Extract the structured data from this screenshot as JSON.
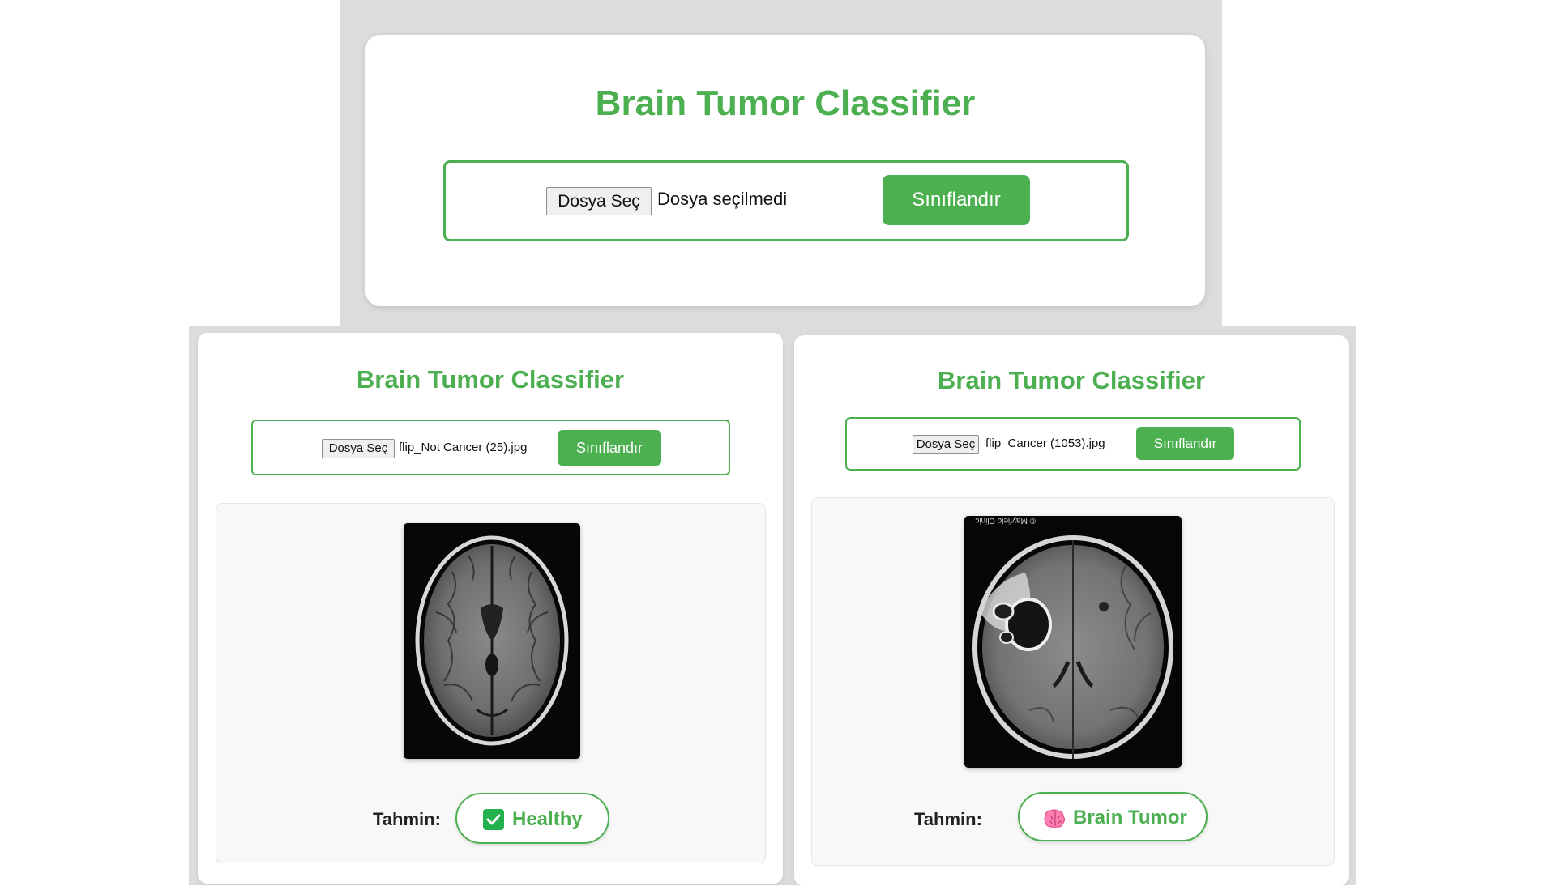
{
  "top": {
    "title": "Brain Tumor Classifier",
    "file_button": "Dosya Seç",
    "file_status": "Dosya seçilmedi",
    "submit": "Sınıflandır"
  },
  "left": {
    "title": "Brain Tumor Classifier",
    "file_button": "Dosya Seç",
    "file_name": "flip_Not Cancer  (25).jpg",
    "submit": "Sınıflandır",
    "prediction_label": "Tahmin:",
    "prediction": "Healthy",
    "prediction_icon": "check-icon"
  },
  "right": {
    "title": "Brain Tumor Classifier",
    "file_button": "Dosya Seç",
    "file_name": "flip_Cancer (1053).jpg",
    "submit": "Sınıflandır",
    "prediction_label": "Tahmin:",
    "prediction": "Brain Tumor",
    "prediction_icon": "brain-icon",
    "watermark": "© Mayfield Clinic"
  },
  "colors": {
    "accent": "#4caf50",
    "frame": "#dcdcdc",
    "result_bg": "#f8f8f8"
  }
}
